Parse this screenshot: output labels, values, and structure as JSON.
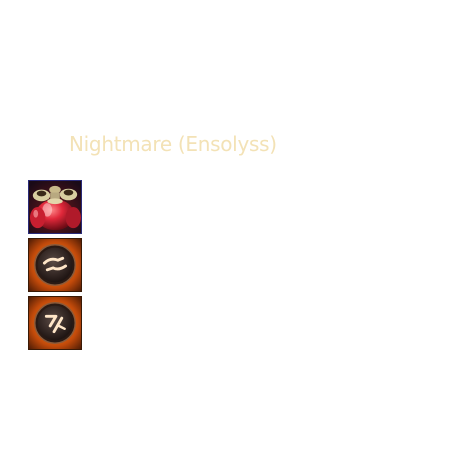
{
  "tooltip": {
    "title": "Nightmare (Ensolyss)",
    "title_color": "#f3e2b6"
  },
  "slots": [
    {
      "icon": "potion-flasks-icon"
    },
    {
      "icon": "dash-rune-icon"
    },
    {
      "icon": "strike-rune-icon"
    }
  ]
}
